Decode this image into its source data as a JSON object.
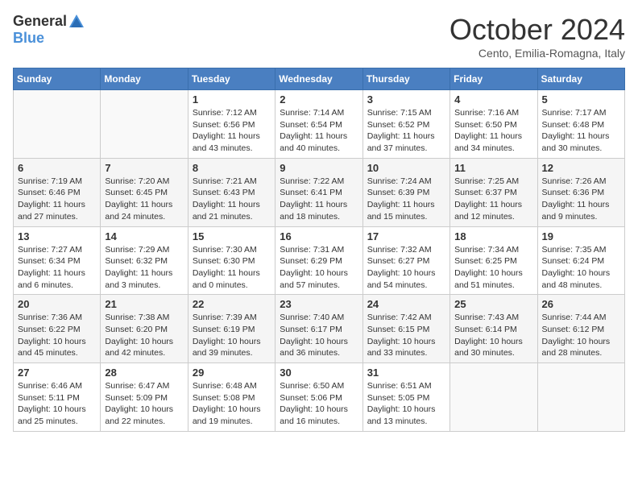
{
  "header": {
    "logo_general": "General",
    "logo_blue": "Blue",
    "month_title": "October 2024",
    "location": "Cento, Emilia-Romagna, Italy"
  },
  "days_of_week": [
    "Sunday",
    "Monday",
    "Tuesday",
    "Wednesday",
    "Thursday",
    "Friday",
    "Saturday"
  ],
  "weeks": [
    [
      {
        "day": "",
        "info": ""
      },
      {
        "day": "",
        "info": ""
      },
      {
        "day": "1",
        "info": "Sunrise: 7:12 AM\nSunset: 6:56 PM\nDaylight: 11 hours and 43 minutes."
      },
      {
        "day": "2",
        "info": "Sunrise: 7:14 AM\nSunset: 6:54 PM\nDaylight: 11 hours and 40 minutes."
      },
      {
        "day": "3",
        "info": "Sunrise: 7:15 AM\nSunset: 6:52 PM\nDaylight: 11 hours and 37 minutes."
      },
      {
        "day": "4",
        "info": "Sunrise: 7:16 AM\nSunset: 6:50 PM\nDaylight: 11 hours and 34 minutes."
      },
      {
        "day": "5",
        "info": "Sunrise: 7:17 AM\nSunset: 6:48 PM\nDaylight: 11 hours and 30 minutes."
      }
    ],
    [
      {
        "day": "6",
        "info": "Sunrise: 7:19 AM\nSunset: 6:46 PM\nDaylight: 11 hours and 27 minutes."
      },
      {
        "day": "7",
        "info": "Sunrise: 7:20 AM\nSunset: 6:45 PM\nDaylight: 11 hours and 24 minutes."
      },
      {
        "day": "8",
        "info": "Sunrise: 7:21 AM\nSunset: 6:43 PM\nDaylight: 11 hours and 21 minutes."
      },
      {
        "day": "9",
        "info": "Sunrise: 7:22 AM\nSunset: 6:41 PM\nDaylight: 11 hours and 18 minutes."
      },
      {
        "day": "10",
        "info": "Sunrise: 7:24 AM\nSunset: 6:39 PM\nDaylight: 11 hours and 15 minutes."
      },
      {
        "day": "11",
        "info": "Sunrise: 7:25 AM\nSunset: 6:37 PM\nDaylight: 11 hours and 12 minutes."
      },
      {
        "day": "12",
        "info": "Sunrise: 7:26 AM\nSunset: 6:36 PM\nDaylight: 11 hours and 9 minutes."
      }
    ],
    [
      {
        "day": "13",
        "info": "Sunrise: 7:27 AM\nSunset: 6:34 PM\nDaylight: 11 hours and 6 minutes."
      },
      {
        "day": "14",
        "info": "Sunrise: 7:29 AM\nSunset: 6:32 PM\nDaylight: 11 hours and 3 minutes."
      },
      {
        "day": "15",
        "info": "Sunrise: 7:30 AM\nSunset: 6:30 PM\nDaylight: 11 hours and 0 minutes."
      },
      {
        "day": "16",
        "info": "Sunrise: 7:31 AM\nSunset: 6:29 PM\nDaylight: 10 hours and 57 minutes."
      },
      {
        "day": "17",
        "info": "Sunrise: 7:32 AM\nSunset: 6:27 PM\nDaylight: 10 hours and 54 minutes."
      },
      {
        "day": "18",
        "info": "Sunrise: 7:34 AM\nSunset: 6:25 PM\nDaylight: 10 hours and 51 minutes."
      },
      {
        "day": "19",
        "info": "Sunrise: 7:35 AM\nSunset: 6:24 PM\nDaylight: 10 hours and 48 minutes."
      }
    ],
    [
      {
        "day": "20",
        "info": "Sunrise: 7:36 AM\nSunset: 6:22 PM\nDaylight: 10 hours and 45 minutes."
      },
      {
        "day": "21",
        "info": "Sunrise: 7:38 AM\nSunset: 6:20 PM\nDaylight: 10 hours and 42 minutes."
      },
      {
        "day": "22",
        "info": "Sunrise: 7:39 AM\nSunset: 6:19 PM\nDaylight: 10 hours and 39 minutes."
      },
      {
        "day": "23",
        "info": "Sunrise: 7:40 AM\nSunset: 6:17 PM\nDaylight: 10 hours and 36 minutes."
      },
      {
        "day": "24",
        "info": "Sunrise: 7:42 AM\nSunset: 6:15 PM\nDaylight: 10 hours and 33 minutes."
      },
      {
        "day": "25",
        "info": "Sunrise: 7:43 AM\nSunset: 6:14 PM\nDaylight: 10 hours and 30 minutes."
      },
      {
        "day": "26",
        "info": "Sunrise: 7:44 AM\nSunset: 6:12 PM\nDaylight: 10 hours and 28 minutes."
      }
    ],
    [
      {
        "day": "27",
        "info": "Sunrise: 6:46 AM\nSunset: 5:11 PM\nDaylight: 10 hours and 25 minutes."
      },
      {
        "day": "28",
        "info": "Sunrise: 6:47 AM\nSunset: 5:09 PM\nDaylight: 10 hours and 22 minutes."
      },
      {
        "day": "29",
        "info": "Sunrise: 6:48 AM\nSunset: 5:08 PM\nDaylight: 10 hours and 19 minutes."
      },
      {
        "day": "30",
        "info": "Sunrise: 6:50 AM\nSunset: 5:06 PM\nDaylight: 10 hours and 16 minutes."
      },
      {
        "day": "31",
        "info": "Sunrise: 6:51 AM\nSunset: 5:05 PM\nDaylight: 10 hours and 13 minutes."
      },
      {
        "day": "",
        "info": ""
      },
      {
        "day": "",
        "info": ""
      }
    ]
  ]
}
